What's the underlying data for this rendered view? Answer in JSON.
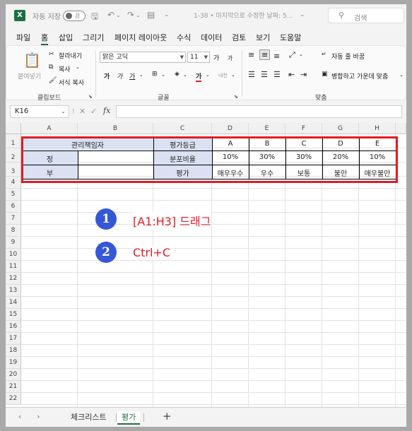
{
  "titlebar": {
    "autosave_label": "자동 저장",
    "autosave_state": "끔",
    "doc_title": "1-38 • 마지막으로 수정한 날짜: 5...",
    "search_placeholder": "검색"
  },
  "menu": [
    "파일",
    "홈",
    "삽입",
    "그리기",
    "페이지 레이아웃",
    "수식",
    "데이터",
    "검토",
    "보기",
    "도움말"
  ],
  "menu_active": "홈",
  "ribbon": {
    "clipboard": {
      "paste": "붙여넣기",
      "cut": "잘라내기",
      "copy": "복사",
      "format_painter": "서식 복사",
      "group_label": "클립보드"
    },
    "font": {
      "font_name": "맑은 고딕",
      "font_size": "11",
      "grow": "가",
      "shrink": "가",
      "bold": "가",
      "italic": "가",
      "underline": "가",
      "color_a": "가",
      "phonetic": "내천",
      "group_label": "글꼴"
    },
    "alignment": {
      "wrap_text": "자동 줄 바꿈",
      "merge_center": "병합하고 가운데 맞춤",
      "group_label": "맞춤"
    }
  },
  "formula_bar": {
    "name_box": "K16",
    "fx": "fx",
    "value": ""
  },
  "columns": [
    "A",
    "B",
    "C",
    "D",
    "E",
    "F",
    "G",
    "H"
  ],
  "rows": [
    "1",
    "2",
    "3",
    "4",
    "5",
    "6",
    "7",
    "8",
    "9",
    "10",
    "11",
    "12",
    "13",
    "14",
    "15",
    "16",
    "17",
    "18",
    "19",
    "20",
    "21",
    "22"
  ],
  "table": {
    "manager_header": "관리책임자",
    "row2_label": "정",
    "row3_label": "부",
    "grade_label": "평가등급",
    "dist_label": "분포비율",
    "eval_label": "평가",
    "grades": [
      "A",
      "B",
      "C",
      "D",
      "E"
    ],
    "ratios": [
      "10%",
      "30%",
      "30%",
      "20%",
      "10%"
    ],
    "evaluations": [
      "매우우수",
      "우수",
      "보통",
      "불만",
      "매우불만"
    ]
  },
  "steps": [
    {
      "num": "1",
      "text": "[A1:H3] 드래그"
    },
    {
      "num": "2",
      "text": "Ctrl+C"
    }
  ],
  "sheet_tabs": [
    "체크리스트",
    "평가"
  ],
  "active_sheet": "평가",
  "colors": {
    "accent": "#1d6f42",
    "highlight_box": "#e31b23",
    "step_circle": "#3458d8",
    "header_fill": "#d9e1f2"
  }
}
